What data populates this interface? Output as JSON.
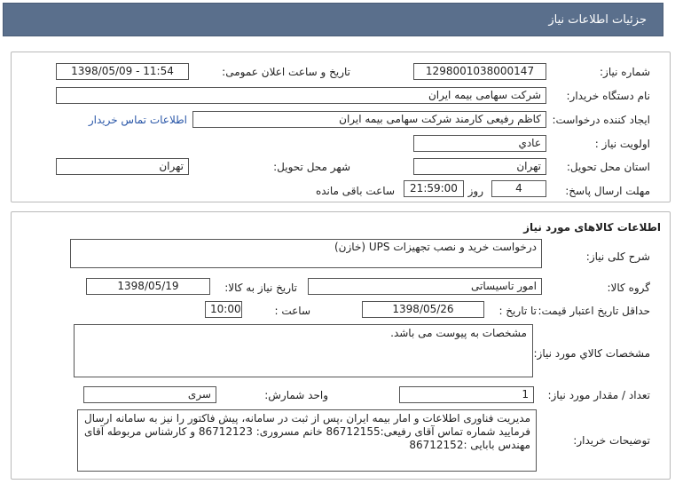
{
  "header": {
    "title": "جزئيات اطلاعات نیاز"
  },
  "info": {
    "need_number_label": "شماره نیاز:",
    "need_number": "1298001038000147",
    "announce_label": "تاریخ و ساعت اعلان عمومی:",
    "announce_value": "1398/05/09 - 11:54",
    "buyer_org_label": "نام دستگاه خریدار:",
    "buyer_org": "شرکت سهامی بیمه ایران",
    "creator_label": "ایجاد کننده درخواست:",
    "creator": "کاظم رفیعی کارمند شرکت سهامی بیمه ایران",
    "contact_link": "اطلاعات تماس خریدار",
    "priority_label": "اولویت نیاز :",
    "priority": "عادي",
    "province_label": "استان محل تحویل:",
    "province": "تهران",
    "city_label": "شهر محل تحویل:",
    "city": "تهران",
    "deadline_label": "مهلت ارسال پاسخ:",
    "days": "4",
    "days_suffix": "روز و",
    "time": "21:59:00",
    "time_suffix": "ساعت باقی مانده"
  },
  "goods": {
    "section_title": "اطلاعات کالاهای مورد نیاز",
    "summary_label": "شرح کلی نیاز:",
    "summary": "درخواست خرید و نصب تجهیزات UPS (خازن)",
    "group_label": "گروه کالا:",
    "group": "امور تاسیساتی",
    "need_date_label": "تاریخ نیاز به کالا:",
    "need_date": "1398/05/19",
    "validity_label": "حداقل تاریخ اعتبار قیمت:",
    "until_date_label": "تا تاریخ :",
    "until_date": "1398/05/26",
    "hour_label": "ساعت :",
    "hour": "10:00",
    "spec_label": "مشخصات کالاي مورد نیاز:",
    "spec": "مشخصات به پیوست می باشد.",
    "qty_label": "تعداد / مقدار مورد نیاز:",
    "qty": "1",
    "unit_label": "واحد شمارش:",
    "unit": "سری",
    "desc_label": "توضیحات خریدار:",
    "desc": "مدیریت فناوری اطلاعات و امار بیمه ایران ،پس از ثبت در سامانه، پیش فاکتور را نیز به سامانه ارسال فرمایید شماره تماس آقای رفیعی:86712155 خانم مسروری: 86712123 و کارشناس مربوطه آقای مهندس بابایی :86712152"
  }
}
